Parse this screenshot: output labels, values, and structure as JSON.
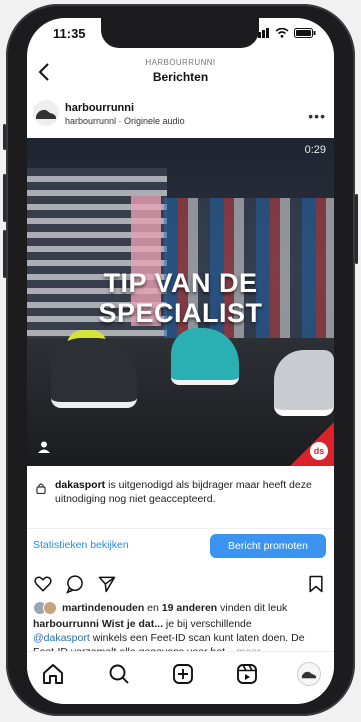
{
  "status_bar": {
    "time": "11:35"
  },
  "header": {
    "account_caps": "HARBOURRUNNI",
    "title": "Berichten"
  },
  "post": {
    "account_name": "harbourrunni",
    "audio": "harbourrunnl · Originele audio",
    "video_timer": "0:29",
    "overlay_text_line1": "TIP VAN DE",
    "overlay_text_line2": "SPECIALIST",
    "brand_badge_text": "ds"
  },
  "invite_notice": {
    "user": "dakasport",
    "text": " is uitgenodigd als bijdrager maar heeft deze uitnodiging nog niet geaccepteerd."
  },
  "actions": {
    "stats_link": "Statistieken bekijken",
    "promote_button": "Bericht promoten"
  },
  "likes": {
    "first_user": "martindenouden",
    "connector": " en ",
    "others": "19 anderen",
    "suffix": " vinden dit leuk"
  },
  "caption": {
    "account": "harbourrunni",
    "bold_text": " Wist je dat...",
    "text1": " je bij verschillende",
    "mention": "@dakasport",
    "text2": " winkels een Feet-ID scan kunt laten doen. De Feet-ID verzamelt alle gegevens voor het...",
    "more": " meer"
  },
  "colors": {
    "accent": "#3b95f0",
    "brand_red": "#d8232a",
    "link": "#2b8be0"
  },
  "icons": [
    "back-arrow-icon",
    "more-icon",
    "heart-icon",
    "comment-icon",
    "share-icon",
    "bookmark-icon",
    "home-icon",
    "search-icon",
    "create-icon",
    "reels-icon",
    "profile-icon",
    "lock-icon",
    "user-tag-icon"
  ]
}
